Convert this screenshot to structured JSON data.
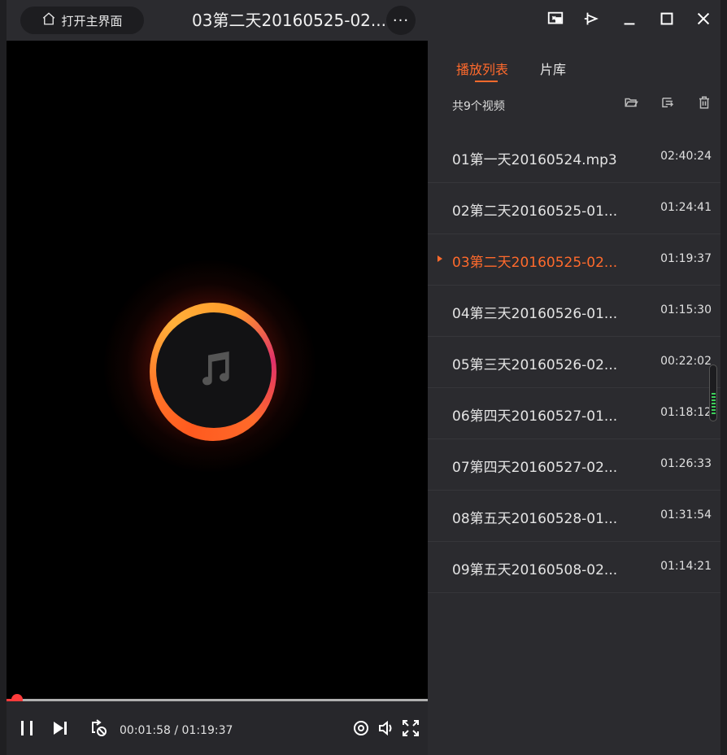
{
  "titlebar": {
    "home_label": "打开主界面",
    "title": "03第二天20160525-02....",
    "more_label": "···"
  },
  "player": {
    "current_time": "00:01:58",
    "separator": " / ",
    "total_time": "01:19:37",
    "progress_fraction": 0.025
  },
  "sidebar": {
    "tabs": [
      {
        "label": "播放列表",
        "active": true
      },
      {
        "label": "片库",
        "active": false
      }
    ],
    "count_label": "共9个视频",
    "items": [
      {
        "name": "01第一天20160524.mp3",
        "duration": "02:40:24",
        "current": false
      },
      {
        "name": "02第二天20160525-01...",
        "duration": "01:24:41",
        "current": false
      },
      {
        "name": "03第二天20160525-02...",
        "duration": "01:19:37",
        "current": true
      },
      {
        "name": "04第三天20160526-01...",
        "duration": "01:15:30",
        "current": false
      },
      {
        "name": "05第三天20160526-02...",
        "duration": "00:22:02",
        "current": false
      },
      {
        "name": "06第四天20160527-01...",
        "duration": "01:18:12",
        "current": false
      },
      {
        "name": "07第四天20160527-02...",
        "duration": "01:26:33",
        "current": false
      },
      {
        "name": "08第五天20160528-01...",
        "duration": "01:31:54",
        "current": false
      },
      {
        "name": "09第五天20160508-02...",
        "duration": "01:14:21",
        "current": false
      }
    ]
  },
  "colors": {
    "accent": "#ff6a2c",
    "progress": "#ff3b3b"
  },
  "icons": [
    "home-icon",
    "more-icon",
    "mini-mode-icon",
    "pin-icon",
    "minimize-icon",
    "maximize-icon",
    "close-icon",
    "music-note-icon",
    "pause-icon",
    "next-icon",
    "loop-icon",
    "settings-icon",
    "volume-icon",
    "fullscreen-icon",
    "open-folder-icon",
    "sort-icon",
    "trash-icon"
  ]
}
